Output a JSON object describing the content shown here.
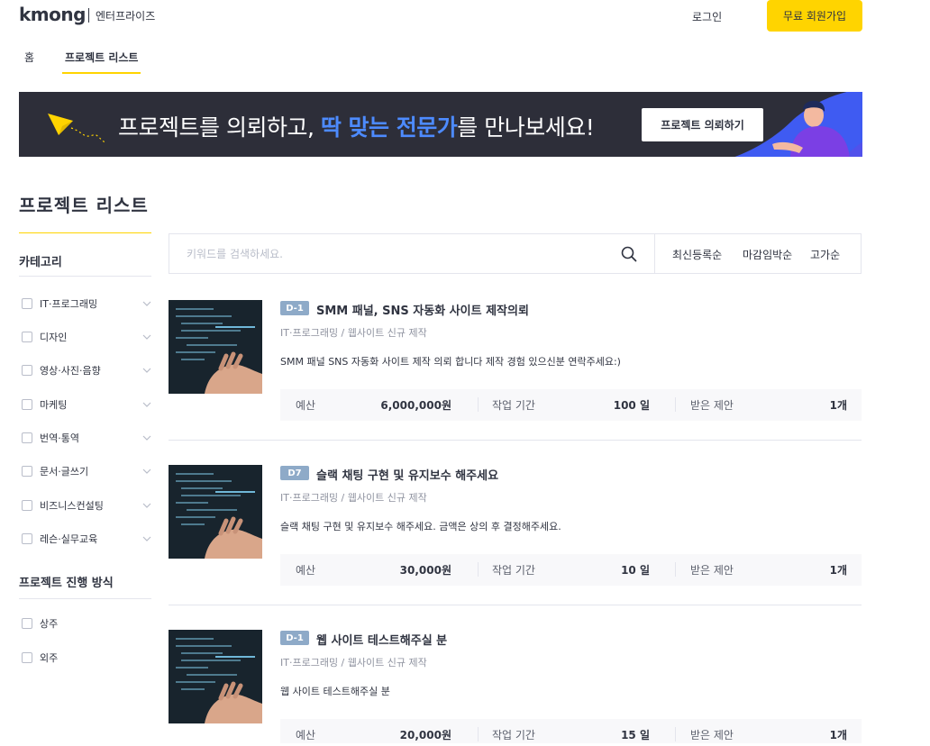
{
  "header": {
    "logo": "kmong",
    "logo_sub": "엔터프라이즈",
    "login": "로그인",
    "signup": "무료 회원가입"
  },
  "tabs": [
    {
      "label": "홈"
    },
    {
      "label": "프로젝트 리스트"
    }
  ],
  "banner": {
    "text_pre": "프로젝트를 의뢰하고, ",
    "text_highlight": "딱 맞는 전문가",
    "text_post": "를 만나보세요!",
    "button": "프로젝트 의뢰하기",
    "highlight_color": "#4d8bff"
  },
  "page_title": "프로젝트 리스트",
  "sidebar": {
    "category_heading": "카테고리",
    "categories": [
      {
        "label": "IT·프로그래밍"
      },
      {
        "label": "디자인"
      },
      {
        "label": "영상·사진·음향"
      },
      {
        "label": "마케팅"
      },
      {
        "label": "번역·통역"
      },
      {
        "label": "문서·글쓰기"
      },
      {
        "label": "비즈니스컨설팅"
      },
      {
        "label": "레슨·실무교육"
      }
    ],
    "method_heading": "프로젝트 진행 방식",
    "methods": [
      {
        "label": "상주"
      },
      {
        "label": "외주"
      }
    ]
  },
  "search": {
    "placeholder": "키워드를 검색하세요.",
    "value": ""
  },
  "sort": [
    "최신등록순",
    "마감임박순",
    "고가순"
  ],
  "meta_labels": {
    "budget": "예산",
    "period": "작업 기간",
    "proposals": "받은 제안"
  },
  "projects": [
    {
      "badge": "D-1",
      "title": "SMM 패널, SNS 자동화 사이트 제작의뢰",
      "category": "IT·프로그래밍 / 웹사이트 신규 제작",
      "description": "SMM 패널 SNS 자동화 사이트 제작 의뢰 합니다 제작 경험 있으신분 연락주세요:)",
      "budget": "6,000,000원",
      "period": "100 일",
      "proposals": "1개"
    },
    {
      "badge": "D7",
      "title": "슬랙 채팅 구현 및 유지보수 해주세요",
      "category": "IT·프로그래밍 / 웹사이트 신규 제작",
      "description": "슬랙 채팅 구현 및 유지보수 해주세요. 금액은 상의 후 결정해주세요.",
      "budget": "30,000원",
      "period": "10 일",
      "proposals": "1개"
    },
    {
      "badge": "D-1",
      "title": "웹 사이트 테스트해주실 분",
      "category": "IT·프로그래밍 / 웹사이트 신규 제작",
      "description": "웹 사이트 테스트해주실 분",
      "budget": "20,000원",
      "period": "15 일",
      "proposals": "1개"
    }
  ],
  "colors": {
    "accent": "#ffd400",
    "text": "#303441",
    "banner_bg": "#2d2e39",
    "badge": "#8eaac8"
  }
}
